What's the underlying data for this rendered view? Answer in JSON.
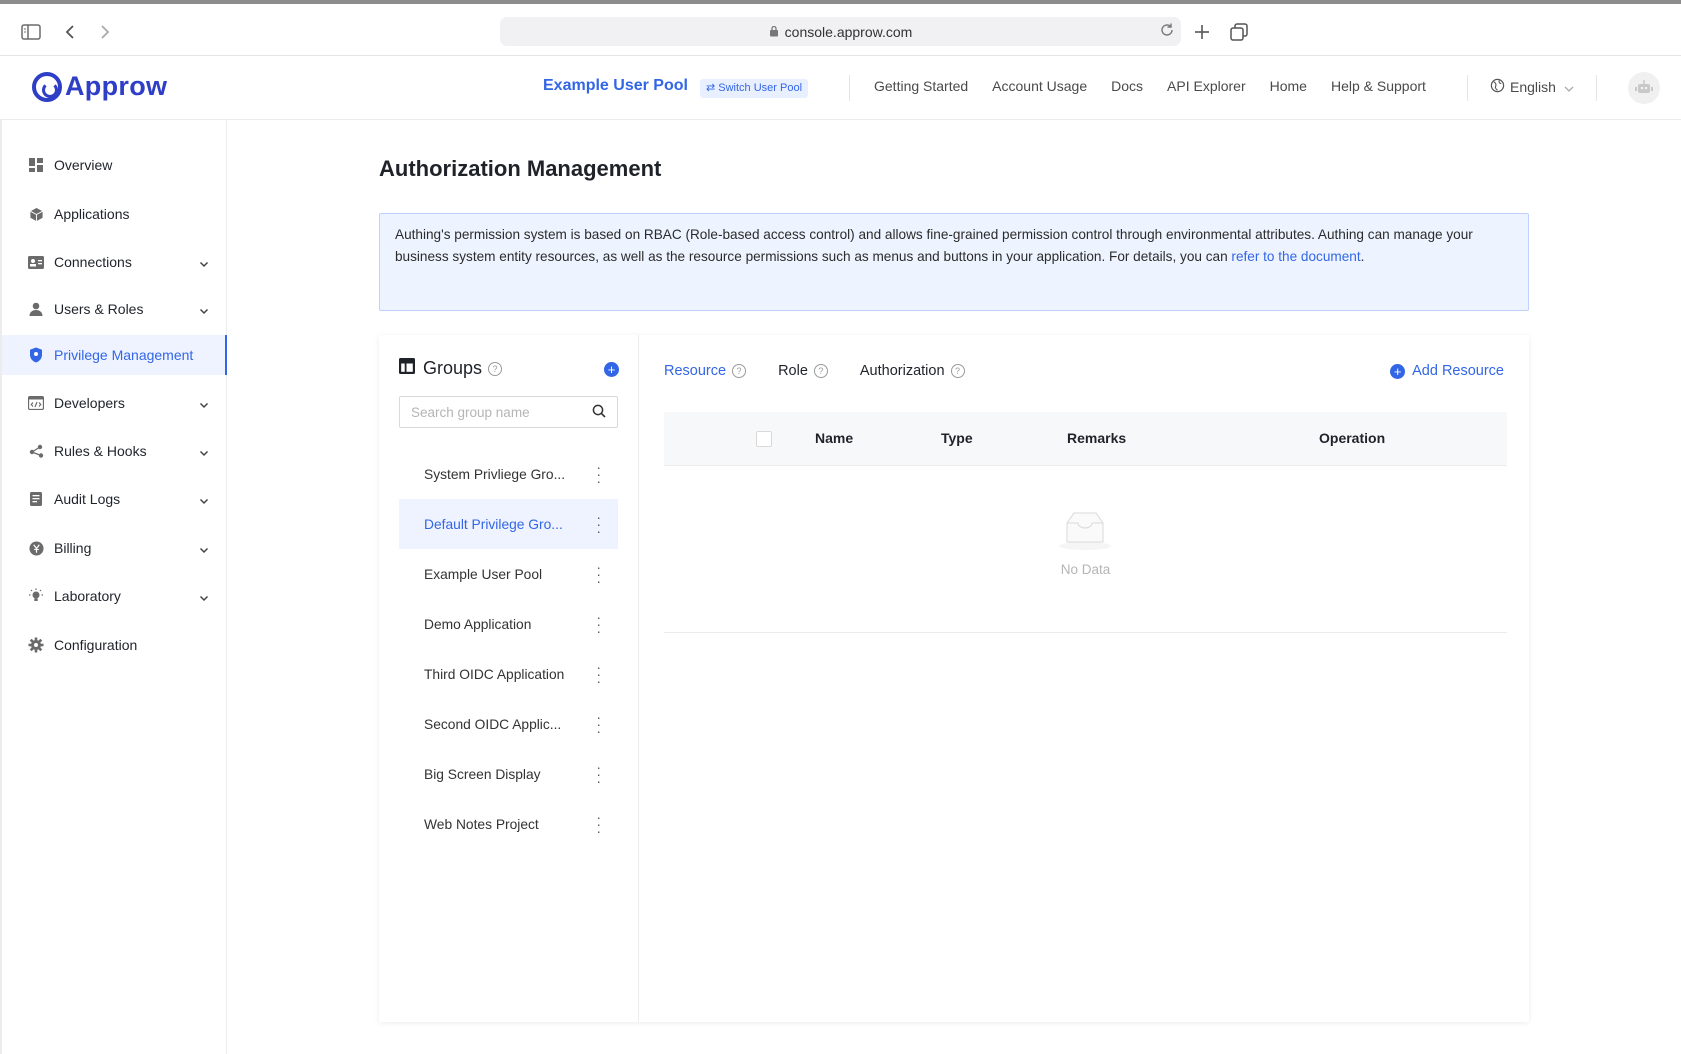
{
  "browser": {
    "url": "console.approw.com"
  },
  "header": {
    "logo_text": "Approw",
    "pool_name": "Example User Pool",
    "switch_pool_label": "Switch User Pool",
    "nav": [
      "Getting Started",
      "Account Usage",
      "Docs",
      "API Explorer",
      "Home",
      "Help & Support"
    ],
    "language": "English"
  },
  "sidebar": {
    "items": [
      {
        "label": "Overview",
        "icon": "dashboard-icon",
        "has_arrow": false
      },
      {
        "label": "Applications",
        "icon": "cube-icon",
        "has_arrow": false
      },
      {
        "label": "Connections",
        "icon": "id-card-icon",
        "has_arrow": true
      },
      {
        "label": "Users & Roles",
        "icon": "user-icon",
        "has_arrow": true
      },
      {
        "label": "Privilege Management",
        "icon": "shield-icon",
        "has_arrow": false,
        "active": true
      },
      {
        "label": "Developers",
        "icon": "code-window-icon",
        "has_arrow": true
      },
      {
        "label": "Rules & Hooks",
        "icon": "share-nodes-icon",
        "has_arrow": true
      },
      {
        "label": "Audit Logs",
        "icon": "document-icon",
        "has_arrow": true
      },
      {
        "label": "Billing",
        "icon": "yen-coin-icon",
        "has_arrow": true
      },
      {
        "label": "Laboratory",
        "icon": "bulb-icon",
        "has_arrow": true
      },
      {
        "label": "Configuration",
        "icon": "gear-icon",
        "has_arrow": false
      }
    ]
  },
  "main": {
    "title": "Authorization Management",
    "alert": {
      "text": "Authing's permission system is based on RBAC (Role-based access control) and allows fine-grained permission control through environmental attributes. Authing can manage your business system entity resources, as well as the resource permissions such as menus and buttons in your application. For details, you can ",
      "link": "refer to the document",
      "end": "."
    },
    "groups": {
      "title": "Groups",
      "search_placeholder": "Search group name",
      "items": [
        "System Privliege Gro...",
        "Default Privilege Gro...",
        "Example User Pool",
        "Demo Application",
        "Third OIDC Application",
        "Second OIDC Applic...",
        "Big Screen Display",
        "Web Notes Project"
      ],
      "active_index": 1
    },
    "tabs": [
      "Resource",
      "Role",
      "Authorization"
    ],
    "active_tab": 0,
    "add_resource_label": "Add Resource",
    "table": {
      "columns": [
        "Name",
        "Type",
        "Remarks",
        "Operation"
      ],
      "empty_text": "No Data"
    }
  },
  "colors": {
    "accent": "#3366e6",
    "brand": "#2e3ec7",
    "alert_bg": "#eef4ff"
  }
}
